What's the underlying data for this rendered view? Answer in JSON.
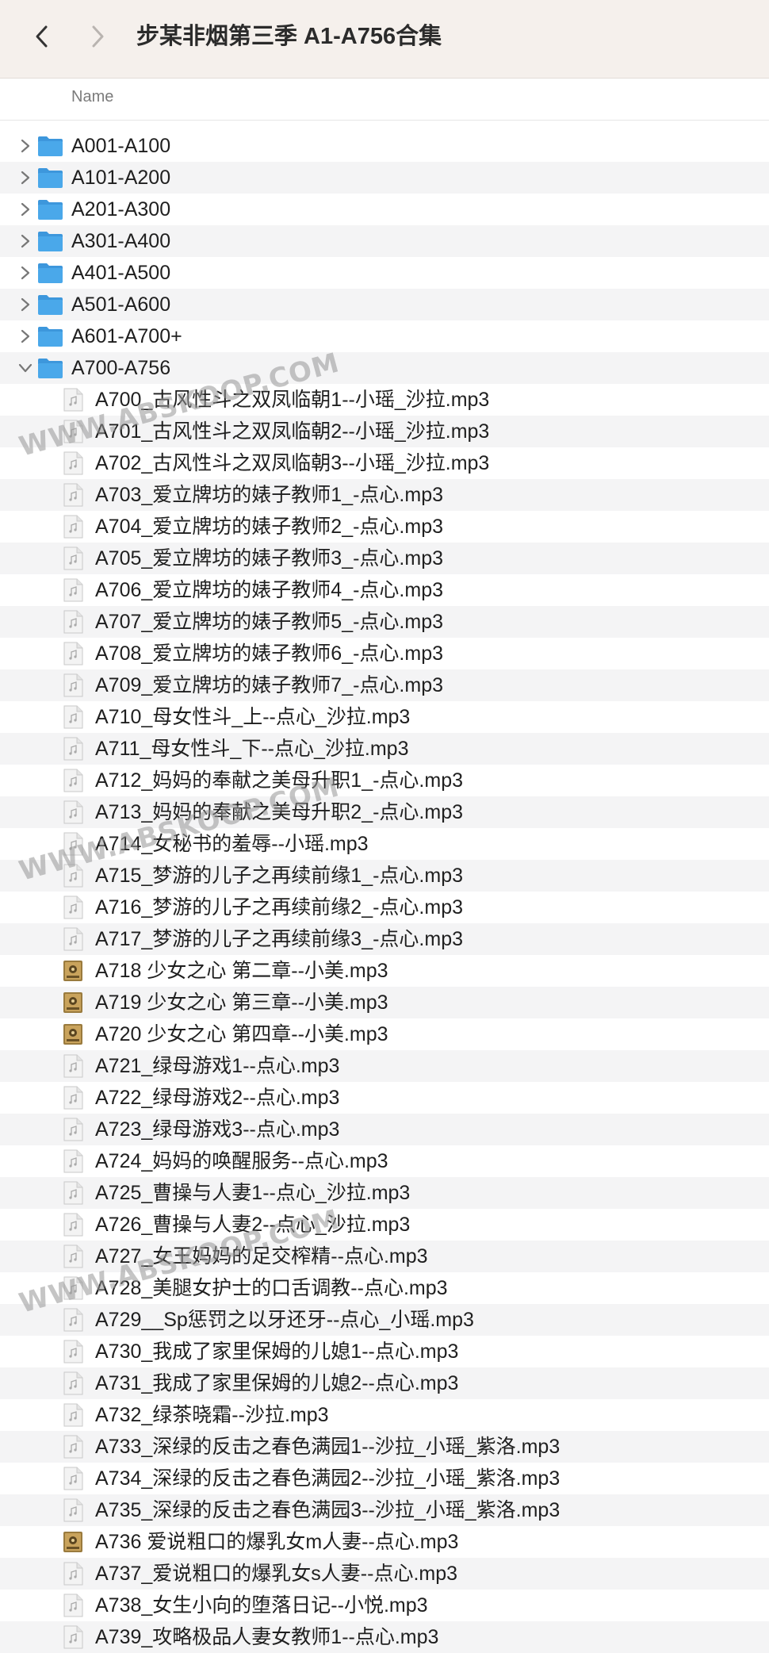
{
  "window": {
    "title": "步某非烟第三季 A1-A756合集",
    "back_icon": "chevron-left-icon",
    "forward_icon": "chevron-right-icon"
  },
  "header": {
    "name_column": "Name"
  },
  "folders": [
    {
      "name": "A001-A100",
      "expanded": false
    },
    {
      "name": "A101-A200",
      "expanded": false
    },
    {
      "name": "A201-A300",
      "expanded": false
    },
    {
      "name": "A301-A400",
      "expanded": false
    },
    {
      "name": "A401-A500",
      "expanded": false
    },
    {
      "name": "A501-A600",
      "expanded": false
    },
    {
      "name": "A601-A700+",
      "expanded": false
    },
    {
      "name": "A700-A756",
      "expanded": true
    }
  ],
  "files": [
    {
      "name": "A700_古风性斗之双凤临朝1--小瑶_沙拉.mp3",
      "icon": "audio"
    },
    {
      "name": "A701_古风性斗之双凤临朝2--小瑶_沙拉.mp3",
      "icon": "audio"
    },
    {
      "name": "A702_古风性斗之双凤临朝3--小瑶_沙拉.mp3",
      "icon": "audio"
    },
    {
      "name": "A703_爱立牌坊的婊子教师1_-点心.mp3",
      "icon": "audio"
    },
    {
      "name": "A704_爱立牌坊的婊子教师2_-点心.mp3",
      "icon": "audio"
    },
    {
      "name": "A705_爱立牌坊的婊子教师3_-点心.mp3",
      "icon": "audio"
    },
    {
      "name": "A706_爱立牌坊的婊子教师4_-点心.mp3",
      "icon": "audio"
    },
    {
      "name": "A707_爱立牌坊的婊子教师5_-点心.mp3",
      "icon": "audio"
    },
    {
      "name": "A708_爱立牌坊的婊子教师6_-点心.mp3",
      "icon": "audio"
    },
    {
      "name": "A709_爱立牌坊的婊子教师7_-点心.mp3",
      "icon": "audio"
    },
    {
      "name": "A710_母女性斗_上--点心_沙拉.mp3",
      "icon": "audio"
    },
    {
      "name": "A711_母女性斗_下--点心_沙拉.mp3",
      "icon": "audio"
    },
    {
      "name": "A712_妈妈的奉献之美母升职1_-点心.mp3",
      "icon": "audio"
    },
    {
      "name": "A713_妈妈的奉献之美母升职2_-点心.mp3",
      "icon": "audio"
    },
    {
      "name": "A714_女秘书的羞辱--小瑶.mp3",
      "icon": "audio"
    },
    {
      "name": "A715_梦游的儿子之再续前缘1_-点心.mp3",
      "icon": "audio"
    },
    {
      "name": "A716_梦游的儿子之再续前缘2_-点心.mp3",
      "icon": "audio"
    },
    {
      "name": "A717_梦游的儿子之再续前缘3_-点心.mp3",
      "icon": "audio"
    },
    {
      "name": "A718 少女之心 第二章--小美.mp3",
      "icon": "album-art"
    },
    {
      "name": "A719 少女之心 第三章--小美.mp3",
      "icon": "album-art"
    },
    {
      "name": "A720 少女之心 第四章--小美.mp3",
      "icon": "album-art"
    },
    {
      "name": "A721_绿母游戏1--点心.mp3",
      "icon": "audio"
    },
    {
      "name": "A722_绿母游戏2--点心.mp3",
      "icon": "audio"
    },
    {
      "name": "A723_绿母游戏3--点心.mp3",
      "icon": "audio"
    },
    {
      "name": "A724_妈妈的唤醒服务--点心.mp3",
      "icon": "audio"
    },
    {
      "name": "A725_曹操与人妻1--点心_沙拉.mp3",
      "icon": "audio"
    },
    {
      "name": "A726_曹操与人妻2--点心_沙拉.mp3",
      "icon": "audio"
    },
    {
      "name": "A727_女王妈妈的足交榨精--点心.mp3",
      "icon": "audio"
    },
    {
      "name": "A728_美腿女护士的口舌调教--点心.mp3",
      "icon": "audio"
    },
    {
      "name": "A729__Sp惩罚之以牙还牙--点心_小瑶.mp3",
      "icon": "audio"
    },
    {
      "name": "A730_我成了家里保姆的儿媳1--点心.mp3",
      "icon": "audio"
    },
    {
      "name": "A731_我成了家里保姆的儿媳2--点心.mp3",
      "icon": "audio"
    },
    {
      "name": "A732_绿茶晓霜--沙拉.mp3",
      "icon": "audio"
    },
    {
      "name": "A733_深绿的反击之春色满园1--沙拉_小瑶_紫洛.mp3",
      "icon": "audio"
    },
    {
      "name": "A734_深绿的反击之春色满园2--沙拉_小瑶_紫洛.mp3",
      "icon": "audio"
    },
    {
      "name": "A735_深绿的反击之春色满园3--沙拉_小瑶_紫洛.mp3",
      "icon": "audio"
    },
    {
      "name": "A736 爱说粗口的爆乳女m人妻--点心.mp3",
      "icon": "album-art"
    },
    {
      "name": "A737_爱说粗口的爆乳女s人妻--点心.mp3",
      "icon": "audio"
    },
    {
      "name": "A738_女生小向的堕落日记--小悦.mp3",
      "icon": "audio"
    },
    {
      "name": "A739_攻略极品人妻女教师1--点心.mp3",
      "icon": "audio"
    }
  ],
  "watermarks": [
    "WWW.ABSKOOP.COM",
    "WWW.ABSKOOP.COM",
    "WWW.ABSKOOP.COM"
  ],
  "colors": {
    "toolbar_bg": "#f5f0ec",
    "folder_blue": "#4aa8ea",
    "alt_row": "#f4f4f5"
  }
}
